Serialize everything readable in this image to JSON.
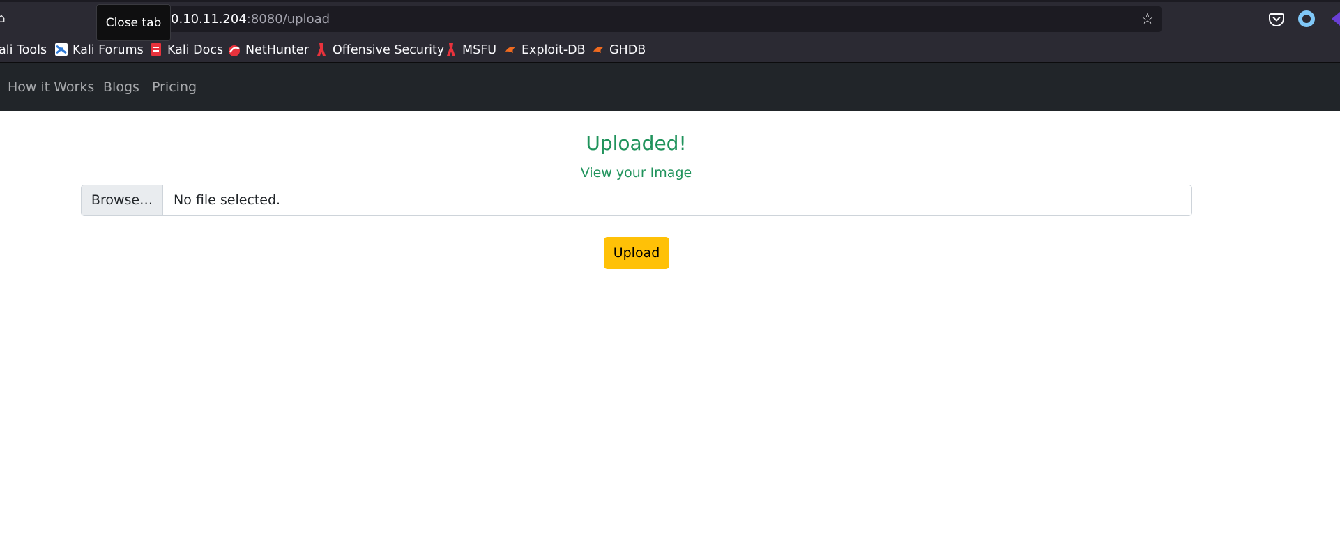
{
  "browser": {
    "url_host": "0.10.11.204",
    "url_rest": ":8080/upload",
    "tooltip": "Close tab",
    "bookmarks": [
      {
        "label": "ali Tools",
        "icon": "kali-tools-icon"
      },
      {
        "label": "Kali Forums",
        "icon": "kali-forums-icon"
      },
      {
        "label": "Kali Docs",
        "icon": "kali-docs-icon"
      },
      {
        "label": "NetHunter",
        "icon": "nethunter-icon"
      },
      {
        "label": "Offensive Security",
        "icon": "offensive-security-icon"
      },
      {
        "label": "MSFU",
        "icon": "msfu-icon"
      },
      {
        "label": "Exploit-DB",
        "icon": "exploit-db-icon"
      },
      {
        "label": "GHDB",
        "icon": "ghdb-icon"
      }
    ]
  },
  "site_nav": {
    "items": [
      "How it Works",
      "Blogs",
      "Pricing"
    ]
  },
  "upload_page": {
    "status_heading": "Uploaded!",
    "view_link": "View your Image",
    "browse_label": "Browse…",
    "file_status": "No file selected.",
    "upload_label": "Upload"
  },
  "colors": {
    "success": "#20935c",
    "warning_button": "#ffc107",
    "navbar": "#212529",
    "browser_chrome": "#2b2a33"
  }
}
